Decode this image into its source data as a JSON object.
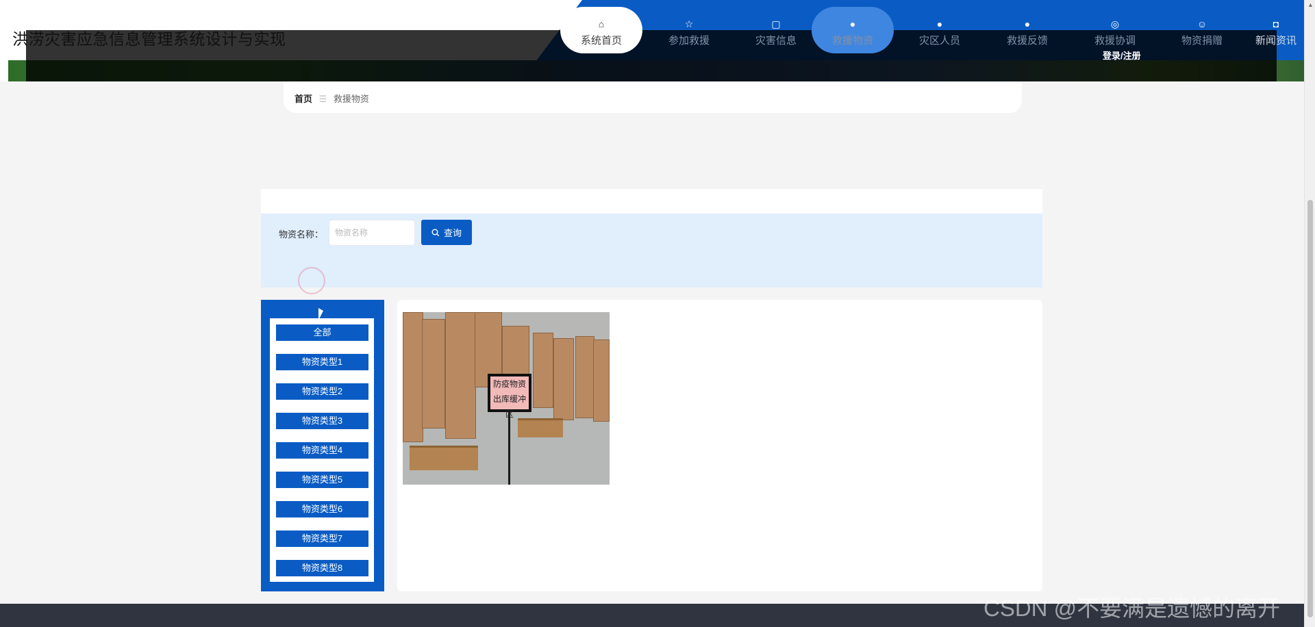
{
  "header": {
    "site_title": "洪涝灾害应急信息管理系统设计与实现",
    "login_label": "登录/注册",
    "nav": [
      {
        "label": "系统首页",
        "icon": "home-icon",
        "glyph": "⌂"
      },
      {
        "label": "参加救援",
        "icon": "star-icon",
        "glyph": "☆"
      },
      {
        "label": "灾害信息",
        "icon": "bag-icon",
        "glyph": "▢"
      },
      {
        "label": "救援物资",
        "icon": "alert-icon",
        "glyph": "●"
      },
      {
        "label": "灾区人员",
        "icon": "question-icon",
        "glyph": "●"
      },
      {
        "label": "救援反馈",
        "icon": "info-icon",
        "glyph": "●"
      },
      {
        "label": "救援协调",
        "icon": "target-icon",
        "glyph": "◎"
      },
      {
        "label": "物资捐赠",
        "icon": "smile-icon",
        "glyph": "☺"
      },
      {
        "label": "新闻资讯",
        "icon": "camera-icon",
        "glyph": "◘"
      }
    ]
  },
  "breadcrumb": {
    "home": "首页",
    "separator": "☰",
    "current": "救援物资"
  },
  "search": {
    "label": "物资名称：",
    "placeholder": "物资名称",
    "value": "",
    "button_label": "查询",
    "button_icon": "search-icon"
  },
  "categories": [
    "全部",
    "物资类型1",
    "物资类型2",
    "物资类型3",
    "物资类型4",
    "物资类型5",
    "物资类型6",
    "物资类型7",
    "物资类型8"
  ],
  "product": {
    "sign_line1": "防疫物资",
    "sign_line2": "出库缓冲区"
  },
  "watermark": "CSDN @不要满是遗憾的离开",
  "colors": {
    "primary": "#0a5cc4",
    "search_panel": "#e1eefc",
    "footer": "#2f3440",
    "active_nav": "#3f86e0"
  }
}
